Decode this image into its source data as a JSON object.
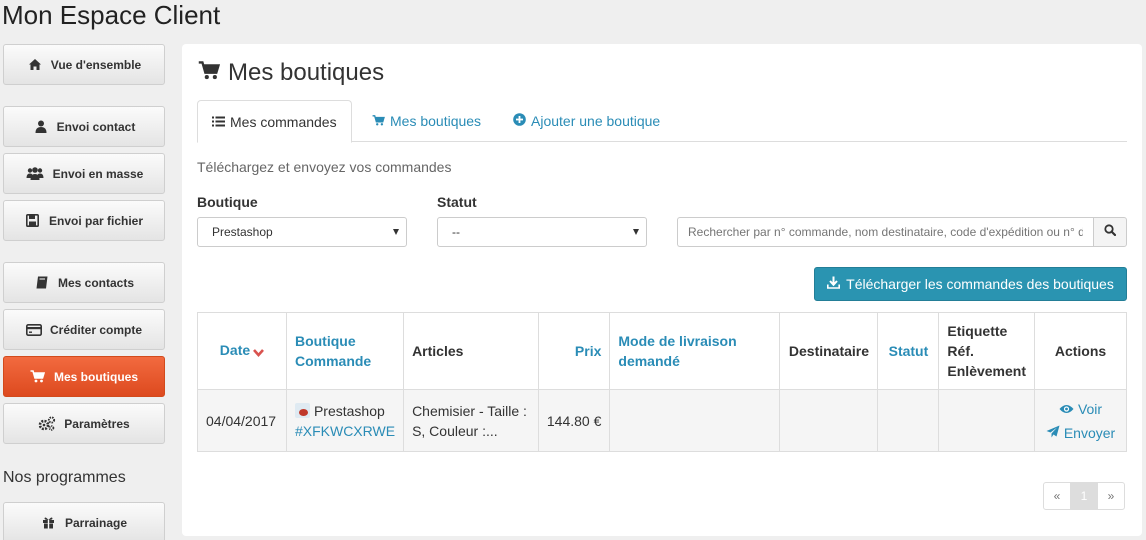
{
  "app": {
    "title": "Mon Espace Client"
  },
  "sidebar": {
    "items": [
      {
        "label": "Vue d'ensemble",
        "icon": "home-icon"
      },
      {
        "label": "Envoi contact",
        "icon": "user-icon"
      },
      {
        "label": "Envoi en masse",
        "icon": "users-icon"
      },
      {
        "label": "Envoi par fichier",
        "icon": "floppy-icon"
      },
      {
        "label": "Mes contacts",
        "icon": "address-book-icon"
      },
      {
        "label": "Créditer compte",
        "icon": "credit-card-icon"
      },
      {
        "label": "Mes boutiques",
        "icon": "cart-icon",
        "active": true
      },
      {
        "label": "Paramètres",
        "icon": "gears-icon"
      }
    ],
    "section_title": "Nos programmes",
    "program_items": [
      {
        "label": "Parrainage",
        "icon": "gift-icon"
      }
    ]
  },
  "main": {
    "title": "Mes boutiques",
    "tabs": [
      {
        "label": "Mes commandes",
        "icon": "list-icon",
        "active": true
      },
      {
        "label": "Mes boutiques",
        "icon": "cart-icon"
      },
      {
        "label": "Ajouter une boutique",
        "icon": "plus-circle-icon"
      }
    ],
    "help_text": "Téléchargez et envoyez vos commandes",
    "filters": {
      "boutique_label": "Boutique",
      "boutique_value": "Prestashop",
      "statut_label": "Statut",
      "statut_value": "--",
      "search_placeholder": "Rechercher par n° commande, nom destinataire, code d'expédition ou n° d"
    },
    "download_button": "Télécharger les commandes des boutiques",
    "table": {
      "headers": {
        "date": "Date",
        "boutique_line1": "Boutique",
        "boutique_line2": "Commande",
        "articles": "Articles",
        "prix": "Prix",
        "livraison_line1": "Mode de livraison",
        "livraison_line2": "demandé",
        "destinataire": "Destinataire",
        "statut": "Statut",
        "etiquette_line1": "Etiquette",
        "etiquette_line2": "Réf.",
        "etiquette_line3": "Enlèvement",
        "actions": "Actions"
      },
      "rows": [
        {
          "date": "04/04/2017",
          "boutique": "Prestashop",
          "commande": "#XFKWCXRWE",
          "articles_line1": "Chemisier - Taille :",
          "articles_line2": "S, Couleur :...",
          "prix": "144.80 €",
          "livraison": "",
          "destinataire": "",
          "statut": "",
          "etiquette": "",
          "action_view": "Voir",
          "action_send": "Envoyer"
        }
      ]
    },
    "pagination": {
      "prev": "«",
      "current": "1",
      "next": "»"
    }
  },
  "colors": {
    "accent": "#2a8cb6",
    "active_nav": "#e8562a",
    "download_button": "#2a94b1"
  }
}
